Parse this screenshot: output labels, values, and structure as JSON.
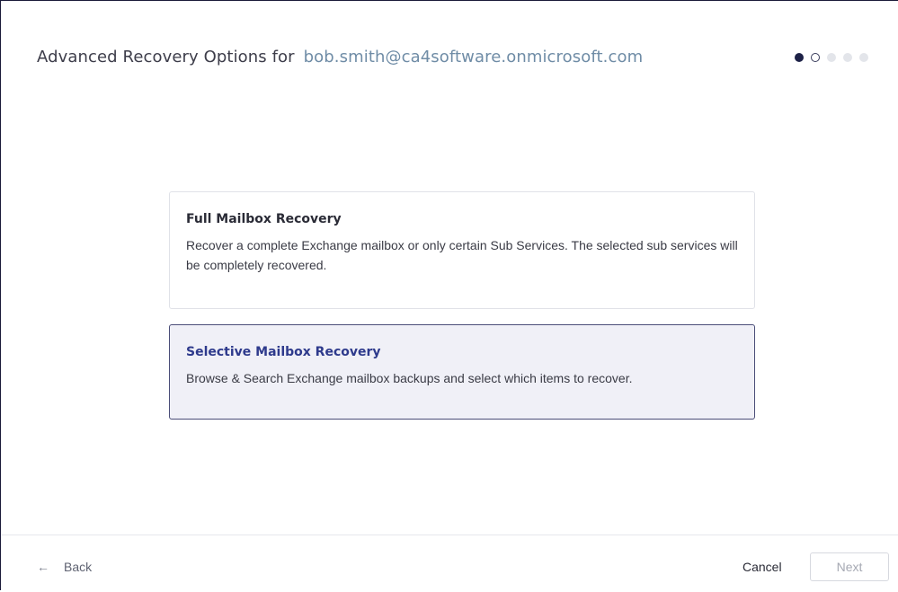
{
  "header": {
    "title": "Advanced Recovery Options for",
    "email": "bob.smith@ca4software.onmicrosoft.com"
  },
  "steps": {
    "total": 5,
    "current": 2
  },
  "options": [
    {
      "title": "Full Mailbox Recovery",
      "description": "Recover a complete Exchange mailbox or only certain Sub Services. The selected sub services will be completely recovered.",
      "selected": false
    },
    {
      "title": "Selective Mailbox Recovery",
      "description": "Browse & Search Exchange mailbox backups and select which items to recover.",
      "selected": true
    }
  ],
  "footer": {
    "back_arrow": "←",
    "back_label": "Back",
    "cancel_label": "Cancel",
    "next_label": "Next"
  },
  "colors": {
    "accent": "#1d2147",
    "selected_bg": "#f0f0f7",
    "selected_border": "#4a4d78",
    "email": "#6f8ca6"
  }
}
